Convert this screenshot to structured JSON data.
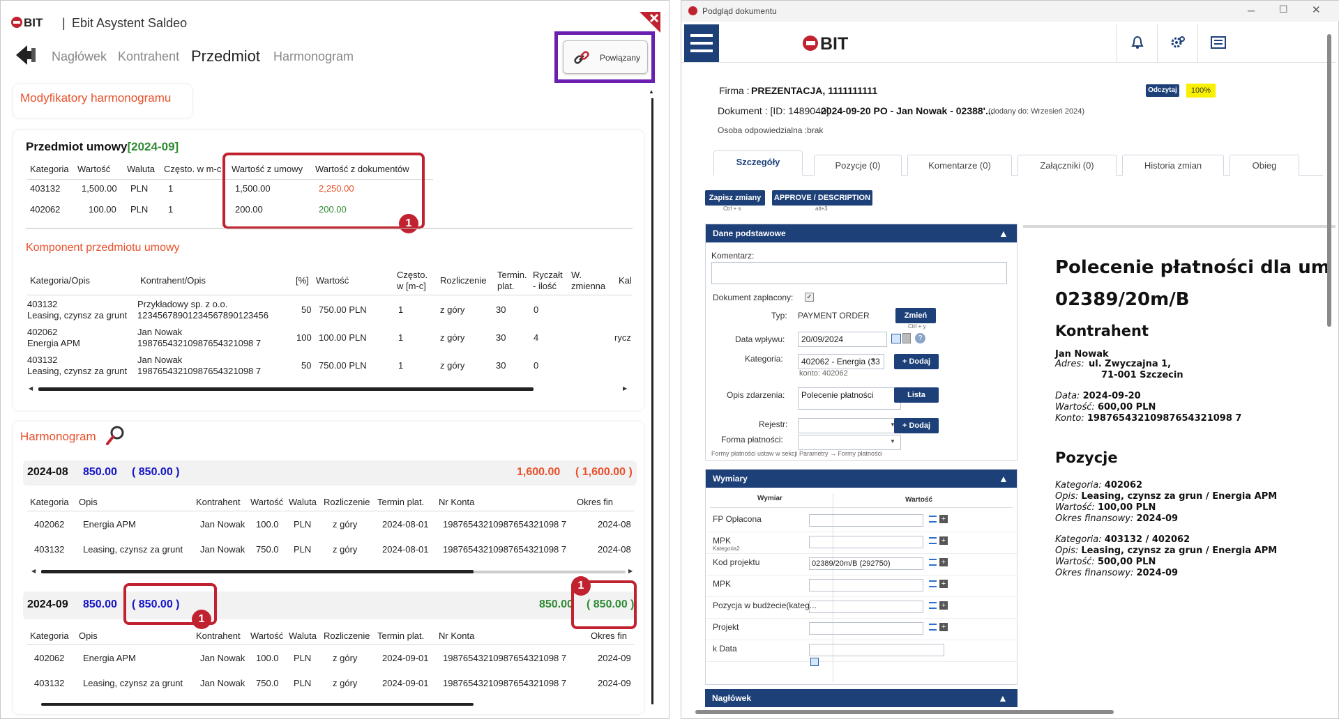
{
  "left": {
    "logo": "EBIT",
    "title": "Ebit Asystent Saldeo",
    "tabs": [
      "Nagłówek",
      "Kontrahent",
      "Przedmiot",
      "Harmonogram"
    ],
    "linked_button": "Powiązany",
    "modifiers_label": "Modyfikatory harmonogramu",
    "subject": {
      "title": "Przedmiot umowy",
      "period": "[2024-09]",
      "columns": [
        "Kategoria",
        "Wartość",
        "Waluta",
        "Często. w m-c",
        "Wartość z umowy",
        "Wartość z dokumentów"
      ],
      "rows": [
        {
          "cat": "403132",
          "val": "1,500.00",
          "cur": "PLN",
          "freq": "1",
          "contract": "1,500.00",
          "docs": "2,250.00"
        },
        {
          "cat": "402062",
          "val": "100.00",
          "cur": "PLN",
          "freq": "1",
          "contract": "200.00",
          "docs": "200.00"
        }
      ]
    },
    "components": {
      "title": "Komponent przedmiotu umowy",
      "columns": [
        "Kategoria/Opis",
        "Kontrahent/Opis",
        "[%]",
        "Wartość",
        "Często. w [m-c]",
        "Rozliczenie",
        "Termin. plat.",
        "Ryczałt - ilość",
        "W. zmienna",
        "Kalk"
      ],
      "rows": [
        {
          "cat": "403132",
          "desc": "Leasing, czynsz za grunt",
          "contr": "Przykładowy sp. z o.o.",
          "contr2": "12345678901234567890123456",
          "pct": "50",
          "val": "750.00 PLN",
          "freq": "1",
          "settle": "z góry",
          "term": "30",
          "lump": "0",
          "var": ""
        },
        {
          "cat": "402062",
          "desc": "Energia APM",
          "contr": "Jan Nowak",
          "contr2": "19876543210987654321098 7",
          "pct": "100",
          "val": "100.00 PLN",
          "freq": "1",
          "settle": "z góry",
          "term": "30",
          "lump": "4",
          "var": "rycz"
        },
        {
          "cat": "403132",
          "desc": "Leasing, czynsz za grunt",
          "contr": "Jan Nowak",
          "contr2": "19876543210987654321098 7",
          "pct": "50",
          "val": "750.00 PLN",
          "freq": "1",
          "settle": "z góry",
          "term": "30",
          "lump": "0",
          "var": ""
        }
      ]
    },
    "schedule": {
      "title": "Harmonogram",
      "columns": [
        "Kategoria",
        "Opis",
        "Kontrahent",
        "Wartość",
        "Waluta",
        "Rozliczenie",
        "Termin plat.",
        "Nr Konta",
        "Okres fin"
      ],
      "periods": [
        {
          "period": "2024-08",
          "v1": "850.00",
          "v2": "( 850.00 )",
          "v3": "1,600.00",
          "v4": "( 1,600.00 )",
          "rows": [
            {
              "cat": "402062",
              "opis": "Energia APM",
              "contr": "Jan Nowak",
              "val": "100.0",
              "cur": "PLN",
              "settle": "z góry",
              "term": "2024-08-01",
              "acct": "19876543210987654321098 7",
              "fin": "2024-08"
            },
            {
              "cat": "403132",
              "opis": "Leasing, czynsz za grunt",
              "contr": "Jan Nowak",
              "val": "750.0",
              "cur": "PLN",
              "settle": "z góry",
              "term": "2024-08-01",
              "acct": "19876543210987654321098 7",
              "fin": "2024-08"
            }
          ]
        },
        {
          "period": "2024-09",
          "v1": "850.00",
          "v2": "( 850.00 )",
          "v3": "850.00",
          "v4": "( 850.00 )",
          "rows": [
            {
              "cat": "402062",
              "opis": "Energia APM",
              "contr": "Jan Nowak",
              "val": "100.0",
              "cur": "PLN",
              "settle": "z góry",
              "term": "2024-09-01",
              "acct": "19876543210987654321098 7",
              "fin": "2024-09"
            },
            {
              "cat": "403132",
              "opis": "Leasing, czynsz za grunt",
              "contr": "Jan Nowak",
              "val": "750.0",
              "cur": "PLN",
              "settle": "z góry",
              "term": "2024-09-01",
              "acct": "19876543210987654321098 7",
              "fin": "2024-09"
            }
          ]
        }
      ]
    },
    "badge": "1"
  },
  "right": {
    "window_title": "Podgląd dokumentu",
    "logo": "EBIT",
    "firma_label": "Firma :",
    "firma": "PREZENTACJA, 1111111111",
    "dokument_label": "Dokument : [ID: 1489040]",
    "dokument": "2024-09-20 PO - Jan Nowak - 02388'...",
    "added": "(dodany do: Wrzesień 2024)",
    "osoba": "Osoba odpowiedzialna :brak",
    "read_btn": "Odczytaj",
    "zoom": "100%",
    "tabs": [
      "Szczegóły",
      "Pozycje (0)",
      "Komentarze (0)",
      "Załączniki (0)",
      "Historia zmian",
      "Obieg"
    ],
    "save_btn": "Zapisz zmiany",
    "save_hint": "Ctrl + s",
    "approve_btn": "APPROVE / DESCRIPTION",
    "approve_hint": "alt+3",
    "basic": {
      "title": "Dane podstawowe",
      "komentarz": "Komentarz:",
      "paid": "Dokument zapłacony:",
      "typ_label": "Typ:",
      "typ": "PAYMENT ORDER",
      "change_btn": "Zmień",
      "change_hint": "Ctrl + y",
      "date_label": "Data wpływu:",
      "date": "20/09/2024",
      "cat_label": "Kategoria:",
      "cat": "402062 - Energia (33",
      "konto": "konto: 402062",
      "add_btn": "+ Dodaj",
      "opis_label": "Opis zdarzenia:",
      "opis": "Polecenie płatności",
      "lista_btn": "Lista",
      "rejestr_label": "Rejestr:",
      "forma_label": "Forma płatności:",
      "forma_hint": "Formy płatności ustaw w sekcji Parametry → Formy płatności"
    },
    "dims": {
      "title": "Wymiary",
      "col1": "Wymiar",
      "col2": "Wartość",
      "rows": [
        {
          "name": "FP Opłacona",
          "sub": "",
          "val": ""
        },
        {
          "name": "MPK",
          "sub": "Kategoria2",
          "val": ""
        },
        {
          "name": "Kod projektu",
          "sub": "",
          "val": "02389/20m/B (292750)"
        },
        {
          "name": "MPK",
          "sub": "",
          "val": ""
        },
        {
          "name": "Pozycja w budżecie(kateg...",
          "sub": "",
          "val": ""
        },
        {
          "name": "Projekt",
          "sub": "",
          "val": ""
        },
        {
          "name": "k Data",
          "sub": "",
          "val": ""
        }
      ]
    },
    "naglowek": "Nagłówek",
    "doc": {
      "title1": "Polecenie płatności dla um",
      "title2": "02389/20m/B",
      "kontrahent_h": "Kontrahent",
      "name": "Jan Nowak",
      "adres_label": "Adres:",
      "adres1": "ul. Zwyczajna 1,",
      "adres2": "71-001 Szczecin",
      "data_label": "Data:",
      "data": "2024-09-20",
      "wartosc_label": "Wartość:",
      "wartosc": "600,00 PLN",
      "konto_label": "Konto:",
      "konto": "19876543210987654321098 7",
      "pozycje_h": "Pozycje",
      "items": [
        {
          "kat": "402062",
          "opis": "Leasing, czynsz za grun / Energia APM",
          "wart": "100,00 PLN",
          "okres": "2024-09"
        },
        {
          "kat": "403132 / 402062",
          "opis": "Leasing, czynsz za grun / Energia APM",
          "wart": "500,00 PLN",
          "okres": "2024-09"
        }
      ],
      "kat_label": "Kategoria:",
      "opis_label": "Opis:",
      "okres_label": "Okres finansowy:"
    }
  }
}
